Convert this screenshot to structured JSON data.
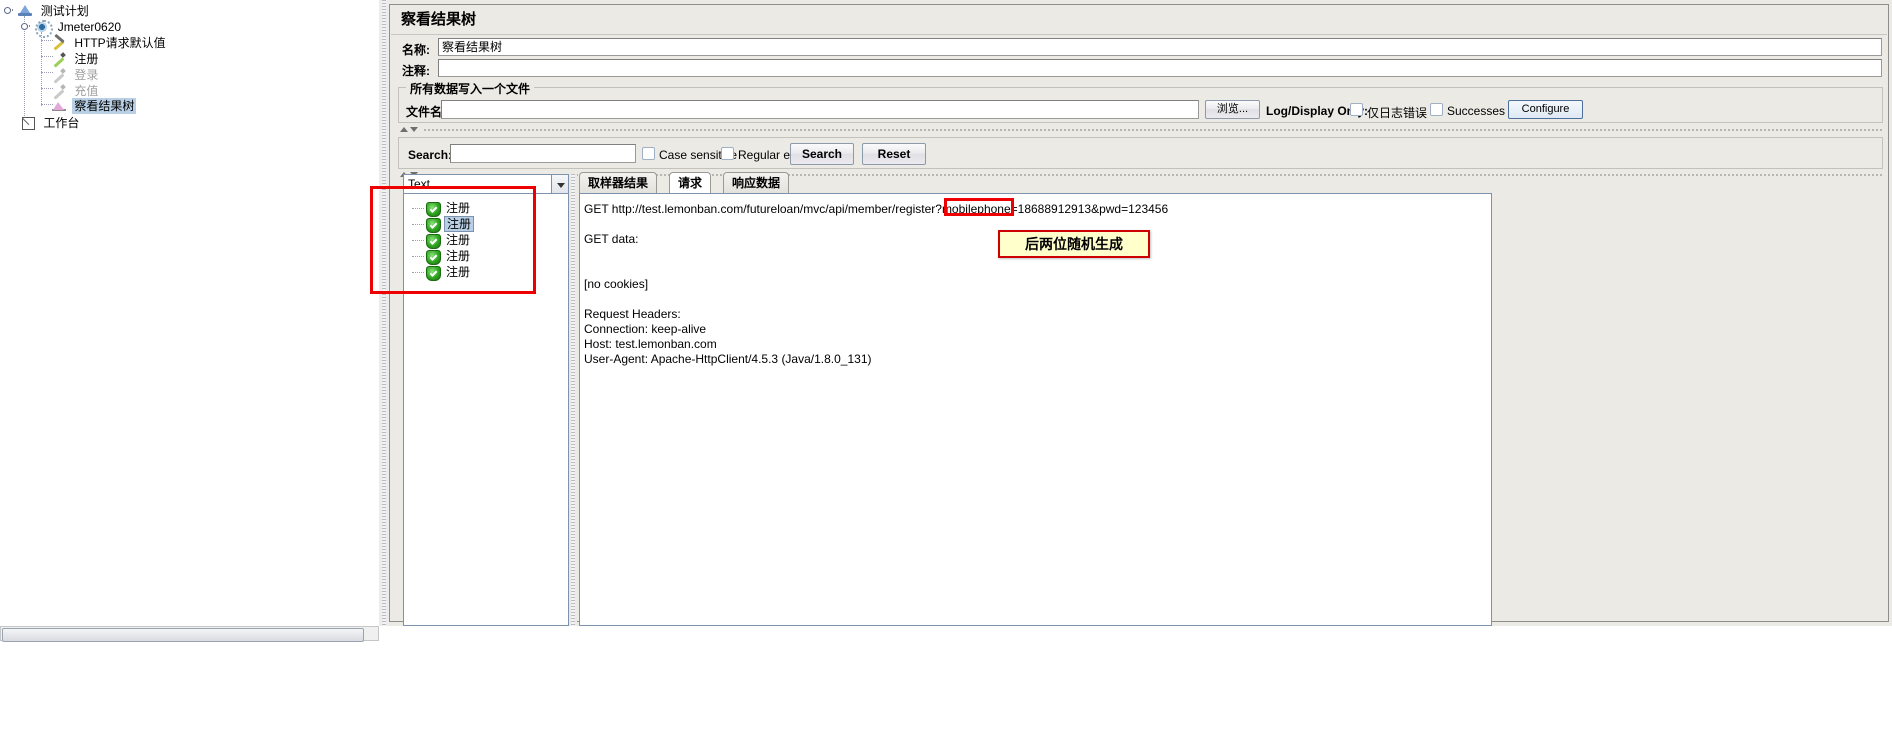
{
  "tree": {
    "nodes": [
      {
        "label": "测试计划",
        "icon": "test-plan-icon",
        "state": "normal",
        "depth": 0
      },
      {
        "label": "Jmeter0620",
        "icon": "thread-group-icon",
        "state": "normal",
        "depth": 1
      },
      {
        "label": "HTTP请求默认值",
        "icon": "http-defaults-icon",
        "state": "normal",
        "depth": 2
      },
      {
        "label": "注册",
        "icon": "http-sampler-icon",
        "state": "normal",
        "depth": 2
      },
      {
        "label": "登录",
        "icon": "http-sampler-disabled-icon",
        "state": "disabled",
        "depth": 2
      },
      {
        "label": "充值",
        "icon": "http-sampler-disabled-icon",
        "state": "disabled",
        "depth": 2
      },
      {
        "label": "察看结果树",
        "icon": "view-results-tree-icon",
        "state": "selected",
        "depth": 2
      },
      {
        "label": "工作台",
        "icon": "workbench-icon",
        "state": "normal",
        "depth": 0
      }
    ]
  },
  "panel": {
    "title": "察看结果树",
    "name_label": "名称:",
    "name_value": "察看结果树",
    "comment_label": "注释:",
    "comment_value": "",
    "file_group_title": "所有数据写入一个文件",
    "filename_label": "文件名",
    "filename_value": "",
    "browse_button": "浏览...",
    "log_display_label": "Log/Display Only:",
    "errors_checkbox": "仅日志错误",
    "successes_checkbox": "Successes",
    "configure_button": "Configure"
  },
  "search": {
    "label": "Search:",
    "value": "",
    "case_sensitive": "Case sensitive",
    "regular_exp": "Regular exp.",
    "search_button": "Search",
    "reset_button": "Reset"
  },
  "results": {
    "render_selected": "Text",
    "items": [
      {
        "label": "注册",
        "status": "success",
        "selected": false
      },
      {
        "label": "注册",
        "status": "success",
        "selected": true
      },
      {
        "label": "注册",
        "status": "success",
        "selected": false
      },
      {
        "label": "注册",
        "status": "success",
        "selected": false
      },
      {
        "label": "注册",
        "status": "success",
        "selected": false
      }
    ]
  },
  "tabs": [
    {
      "label": "取样器结果",
      "active": false
    },
    {
      "label": "请求",
      "active": true
    },
    {
      "label": "响应数据",
      "active": false
    }
  ],
  "request": {
    "lines": [
      "GET http://test.lemonban.com/futureloan/mvc/api/member/register?mobilephone=18688912913&pwd=123456",
      "",
      "GET data:",
      "",
      "",
      "[no cookies]",
      "",
      "Request Headers:",
      "Connection: keep-alive",
      "Host: test.lemonban.com",
      "User-Agent: Apache-HttpClient/4.5.3 (Java/1.8.0_131)"
    ]
  },
  "annotations": {
    "note_text": "后两位随机生成",
    "highlight_value": "18688912913",
    "accent_red": "#ee0000",
    "note_bg": "#ffffcc"
  }
}
